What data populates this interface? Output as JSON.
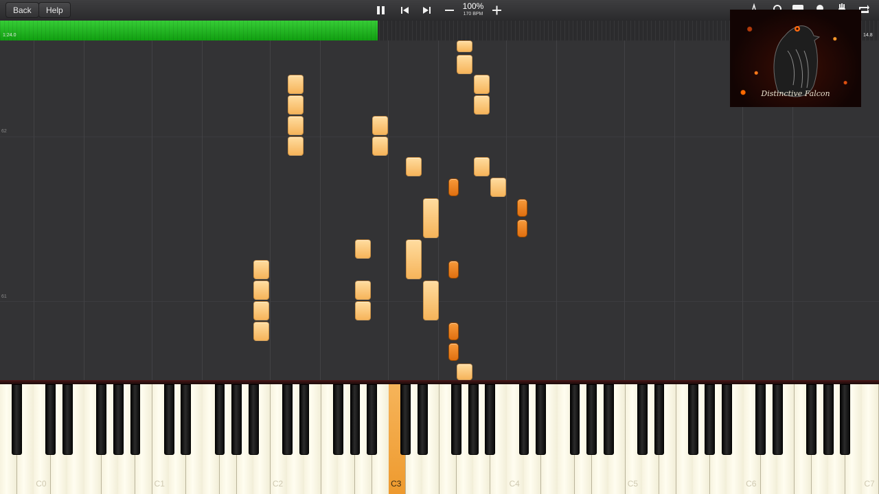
{
  "toolbar": {
    "back_label": "Back",
    "help_label": "Help",
    "speed_percent": "100%",
    "tempo": "170 BPM",
    "icons": [
      "pause-icon",
      "previous-icon",
      "next-icon",
      "minus-icon",
      "plus-icon"
    ]
  },
  "progress": {
    "fraction": 0.43,
    "time_left": "1:24.0",
    "time_right": "14.8",
    "color": "#22b822"
  },
  "roll": {
    "measure_numbers": [
      "62",
      "61"
    ]
  },
  "keyboard": {
    "octave_labels": [
      "C0",
      "C1",
      "C2",
      "C3",
      "C4",
      "C5",
      "C6",
      "C7"
    ],
    "highlighted_key": "C3"
  },
  "thumbnail": {
    "caption": "Distinctive Falcon"
  },
  "colors": {
    "note_light": "#f9c37a",
    "note_dark": "#ec7f1e",
    "background": "#333335"
  }
}
